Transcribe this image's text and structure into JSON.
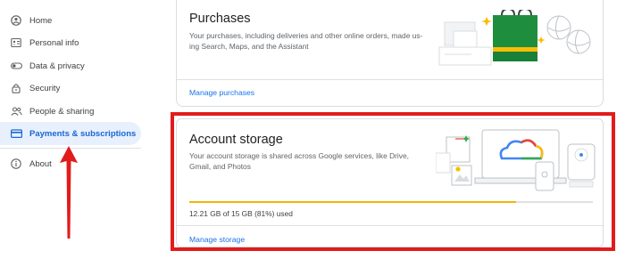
{
  "sidebar": {
    "items": [
      {
        "label": "Home",
        "icon": "home-icon"
      },
      {
        "label": "Personal info",
        "icon": "id-card-icon"
      },
      {
        "label": "Data & privacy",
        "icon": "toggle-icon"
      },
      {
        "label": "Security",
        "icon": "lock-icon"
      },
      {
        "label": "People & sharing",
        "icon": "people-icon"
      },
      {
        "label": "Payments & subscriptions",
        "icon": "credit-card-icon",
        "active": true
      },
      {
        "label": "About",
        "icon": "info-icon"
      }
    ]
  },
  "purchases": {
    "title": "Purchases",
    "description_line1": "Your purchases, including deliveries and other online orders, made us-",
    "description_line2": "ing Search, Maps, and the Assistant",
    "link": "Manage purchases"
  },
  "storage": {
    "title": "Account storage",
    "description_line1": "Your account storage is shared across Google services, like Drive,",
    "description_line2": "Gmail, and Photos",
    "usage_text": "12.21 GB of 15 GB (81%) used",
    "usage_fraction": 0.81,
    "link": "Manage storage"
  },
  "colors": {
    "accent": "#1a73e8",
    "active_bg": "#e8f0fe",
    "highlight": "#e21b1b",
    "progress": "#f4b400"
  }
}
